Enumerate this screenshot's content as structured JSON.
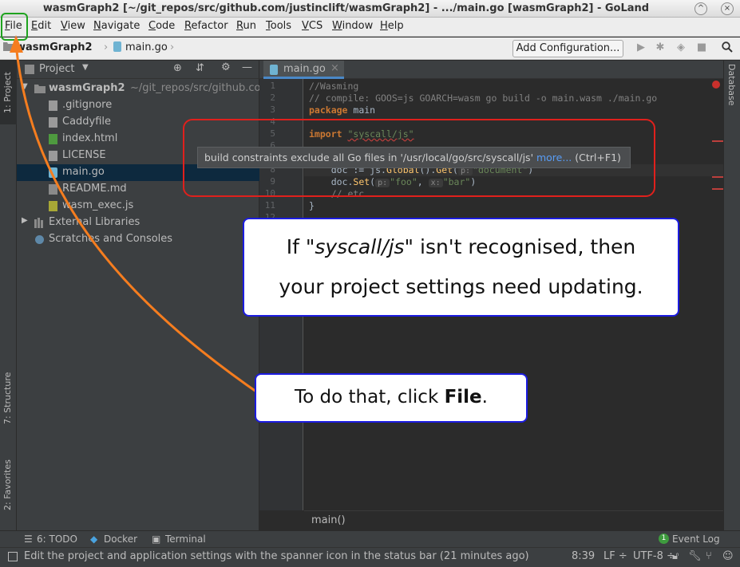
{
  "window": {
    "title": "wasmGraph2 [~/git_repos/src/github.com/justinclift/wasmGraph2] - .../main.go [wasmGraph2] - GoLand",
    "minimize_glyph": "^",
    "close_glyph": "×"
  },
  "menu": [
    "File",
    "Edit",
    "View",
    "Navigate",
    "Code",
    "Refactor",
    "Run",
    "Tools",
    "VCS",
    "Window",
    "Help"
  ],
  "navbar": {
    "crumbs": [
      "wasmGraph2",
      "main.go"
    ],
    "add_configuration": "Add Configuration..."
  },
  "left_tabs": {
    "project": "1: Project",
    "structure": "7: Structure",
    "favorites": "2: Favorites"
  },
  "right_tabs": {
    "database": "Database"
  },
  "project_panel": {
    "title": "Project",
    "root": {
      "name": "wasmGraph2",
      "path": "~/git_repos/src/github.co"
    },
    "files": [
      ".gitignore",
      "Caddyfile",
      "index.html",
      "LICENSE",
      "main.go",
      "README.md",
      "wasm_exec.js"
    ],
    "selected_file": "main.go",
    "extra": [
      "External Libraries",
      "Scratches and Consoles"
    ]
  },
  "editor": {
    "tab": "main.go",
    "line_numbers": [
      "1",
      "2",
      "3",
      "4",
      "5",
      "6",
      "7",
      "8",
      "9",
      "10",
      "11",
      "12"
    ],
    "lines": {
      "l1": "//Wasming",
      "l2": "// compile: GOOS=js GOARCH=wasm go build -o main.wasm ./main.go",
      "l3_kw": "package",
      "l3_rest": " main",
      "l5_kw": "import",
      "l5_str": "\"syscall/js\"",
      "l8_a": "    doc := js.",
      "l8_fn": "Global",
      "l8_b": "().",
      "l8_fn2": "Get",
      "l8_c": "(",
      "l8_hint": "p:",
      "l8_str": "\"document\"",
      "l8_d": ")",
      "l9_a": "    doc.",
      "l9_fn": "Set",
      "l9_b": "(",
      "l9_hint1": "p:",
      "l9_str1": "\"foo\"",
      "l9_c": ",",
      "l9_hint2": "x:",
      "l9_str2": "\"bar\"",
      "l9_d": ")",
      "l10": "    // etc",
      "l11": "}"
    },
    "breadcrumb": "main()"
  },
  "tooltip": {
    "text": "build constraints exclude all Go files in '/usr/local/go/src/syscall/js'",
    "more": "more...",
    "shortcut": "(Ctrl+F1)"
  },
  "bottom_tools": {
    "todo": "6: TODO",
    "docker": "Docker",
    "terminal": "Terminal",
    "event_log": "Event Log",
    "event_count": "1"
  },
  "status": {
    "message": "Edit the project and application settings with the spanner icon in the status bar (21 minutes ago)",
    "position": "8:39",
    "line_sep": "LF ÷",
    "encoding": "UTF-8 ÷"
  },
  "callouts": {
    "c1_pre": "If \"",
    "c1_em": "syscall/js",
    "c1_post": "\" isn't recognised, then",
    "c1_line2": "your project settings need updating.",
    "c2_pre": "To do that, click ",
    "c2_bold": "File",
    "c2_post": "."
  },
  "colors": {
    "red_box": "#e0201c",
    "green_box": "#1fa31f",
    "callout_border": "#1c1ce0",
    "arrow": "#f57d1f"
  }
}
